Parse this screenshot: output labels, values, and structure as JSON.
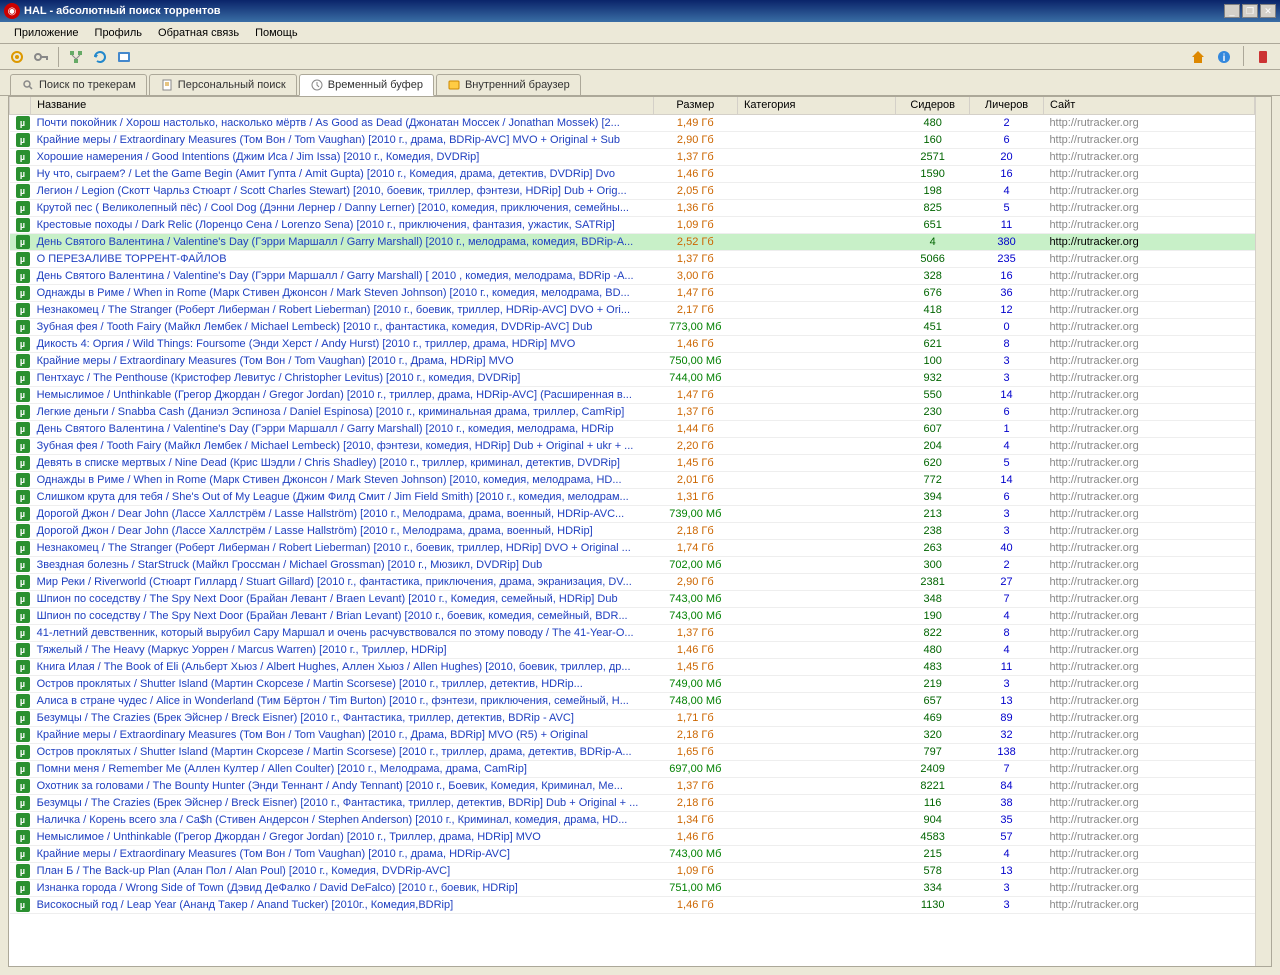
{
  "window": {
    "title": "HAL - абсолютный поиск торрентов"
  },
  "menu": {
    "items": [
      "Приложение",
      "Профиль",
      "Обратная связь",
      "Помощь"
    ]
  },
  "tabs": [
    {
      "icon": "search",
      "label": "Поиск по трекерам",
      "active": false
    },
    {
      "icon": "doc",
      "label": "Персональный поиск",
      "active": false
    },
    {
      "icon": "clock",
      "label": "Временный буфер",
      "active": true
    },
    {
      "icon": "globe",
      "label": "Внутренний браузер",
      "active": false
    }
  ],
  "columns": {
    "title": "Название",
    "size": "Размер",
    "category": "Категория",
    "seeders": "Сидеров",
    "leechers": "Личеров",
    "site": "Сайт"
  },
  "rows": [
    {
      "t": "Почти покойник / Хорош настолько, насколько мёртв / As Good as Dead (Джонатан Моссек / Jonathan Mossek) [2...",
      "s": "1,49 Гб",
      "sc": "o",
      "se": 480,
      "le": 2,
      "w": "http://rutracker.org"
    },
    {
      "t": "Крайние меры / Extraordinary Measures (Том Вон / Tom Vaughan) [2010 г., драма, BDRip-AVC] MVO + Original + Sub",
      "s": "2,90 Гб",
      "sc": "o",
      "se": 160,
      "le": 6,
      "w": "http://rutracker.org"
    },
    {
      "t": "Хорошие намерения / Good Intentions (Джим Иса / Jim Issa) [2010 г., Комедия, DVDRip]",
      "s": "1,37 Гб",
      "sc": "o",
      "se": 2571,
      "le": 20,
      "w": "http://rutracker.org"
    },
    {
      "t": "Ну что, сыграем? / Let the Game Begin (Амит Гупта / Amit Gupta) [2010 г., Комедия, драма, детектив, DVDRip] Dvo",
      "s": "1,46 Гб",
      "sc": "o",
      "se": 1590,
      "le": 16,
      "w": "http://rutracker.org"
    },
    {
      "t": "Легион / Legion (Скотт Чарльз Стюарт / Scott Charles Stewart) [2010, боевик, триллер, фэнтези, HDRip] Dub + Orig...",
      "s": "2,05 Гб",
      "sc": "o",
      "se": 198,
      "le": 4,
      "w": "http://rutracker.org"
    },
    {
      "t": "Крутой пес ( Великолепный пёс) / Cool Dog (Дэнни Лернер / Danny Lerner) [2010, комедия, приключения, семейны...",
      "s": "1,36 Гб",
      "sc": "o",
      "se": 825,
      "le": 5,
      "w": "http://rutracker.org"
    },
    {
      "t": "Крестовые походы / Dark Relic (Лоренцо Сена / Lorenzo Sena) [2010 г., приключения, фантазия, ужастик, SATRip]",
      "s": "1,09 Гб",
      "sc": "o",
      "se": 651,
      "le": 11,
      "w": "http://rutracker.org"
    },
    {
      "t": "День Святого Валентина / Valentine's Day (Гэрри Маршалл / Garry Marshall) [2010 г., мелодрама, комедия, BDRip-A...",
      "s": "2,52 Гб",
      "sc": "o",
      "se": 4,
      "le": 380,
      "w": "http://rutracker.org",
      "sel": true
    },
    {
      "t": "О ПЕРЕЗАЛИВЕ ТОРРЕНТ-ФАЙЛОВ",
      "s": "1,37 Гб",
      "sc": "o",
      "se": 5066,
      "le": 235,
      "w": "http://rutracker.org"
    },
    {
      "t": "День Святого Валентина / Valentine's Day (Гэрри Маршалл / Garry Marshall) [ 2010 , комедия, мелодрама, BDRip -A...",
      "s": "3,00 Гб",
      "sc": "o",
      "se": 328,
      "le": 16,
      "w": "http://rutracker.org"
    },
    {
      "t": "Однажды в Риме / When in Rome (Марк Стивен Джонсон / Mark Steven Johnson) [2010 г., комедия, мелодрама, BD...",
      "s": "1,47 Гб",
      "sc": "o",
      "se": 676,
      "le": 36,
      "w": "http://rutracker.org"
    },
    {
      "t": "Незнакомец / The Stranger (Роберт Либерман / Robert Lieberman) [2010 г., боевик, триллер, HDRip-AVC] DVO + Ori...",
      "s": "2,17 Гб",
      "sc": "o",
      "se": 418,
      "le": 12,
      "w": "http://rutracker.org"
    },
    {
      "t": "Зубная фея / Tooth Fairy (Майкл Лембек / Michael Lembeck) [2010 г., фантастика, комедия, DVDRip-AVC] Dub",
      "s": "773,00 Мб",
      "sc": "g",
      "se": 451,
      "le": 0,
      "w": "http://rutracker.org"
    },
    {
      "t": "Дикость 4: Оргия / Wild Things: Foursome (Энди Херст / Andy Hurst) [2010 г., триллер, драма, HDRip] MVO",
      "s": "1,46 Гб",
      "sc": "o",
      "se": 621,
      "le": 8,
      "w": "http://rutracker.org"
    },
    {
      "t": "Крайние меры / Extraordinary Measures (Том Вон / Tom Vaughan) [2010 г., Драма, HDRip] MVO",
      "s": "750,00 Мб",
      "sc": "g",
      "se": 100,
      "le": 3,
      "w": "http://rutracker.org"
    },
    {
      "t": "Пентхаус / The Penthouse (Кристофер Левитус / Christopher Levitus) [2010 г., комедия, DVDRip]",
      "s": "744,00 Мб",
      "sc": "g",
      "se": 932,
      "le": 3,
      "w": "http://rutracker.org"
    },
    {
      "t": "Немыслимое / Unthinkable (Грегор Джордан / Gregor Jordan) [2010 г., триллер, драма, HDRip-AVC] (Расширенная в...",
      "s": "1,47 Гб",
      "sc": "o",
      "se": 550,
      "le": 14,
      "w": "http://rutracker.org"
    },
    {
      "t": "Легкие деньги / Snabba Cash (Даниэл Эспиноза / Daniel Espinosa) [2010 г., криминальная драма, триллер, CamRip]",
      "s": "1,37 Гб",
      "sc": "o",
      "se": 230,
      "le": 6,
      "w": "http://rutracker.org"
    },
    {
      "t": "День Святого Валентина / Valentine's Day (Гэрри Маршалл / Garry Marshall) [2010 г., комедия, мелодрама, HDRip",
      "s": "1,44 Гб",
      "sc": "o",
      "se": 607,
      "le": 1,
      "w": "http://rutracker.org"
    },
    {
      "t": "Зубная фея / Tooth Fairy (Майкл Лембек / Michael Lembeck) [2010, фэнтези, комедия, HDRip] Dub + Original + ukr + ...",
      "s": "2,20 Гб",
      "sc": "o",
      "se": 204,
      "le": 4,
      "w": "http://rutracker.org"
    },
    {
      "t": "Девять в списке мертвых / Nine Dead (Крис Шэдли / Chris Shadley) [2010 г., триллер, криминал, детектив, DVDRip]",
      "s": "1,45 Гб",
      "sc": "o",
      "se": 620,
      "le": 5,
      "w": "http://rutracker.org"
    },
    {
      "t": "Однажды в Риме / When in Rome (Марк Стивен Джонсон / Mark Steven Johnson) [2010, комедия, мелодрама, HD...",
      "s": "2,01 Гб",
      "sc": "o",
      "se": 772,
      "le": 14,
      "w": "http://rutracker.org"
    },
    {
      "t": "Слишком крута для тебя / She's Out of My League (Джим Филд Смит / Jim Field Smith) [2010 г., комедия, мелодрам...",
      "s": "1,31 Гб",
      "sc": "o",
      "se": 394,
      "le": 6,
      "w": "http://rutracker.org"
    },
    {
      "t": "Дорогой Джон / Dear John (Лассе Халлстрём / Lasse Hallström) [2010 г., Мелодрама, драма, военный, HDRip-AVC...",
      "s": "739,00 Мб",
      "sc": "g",
      "se": 213,
      "le": 3,
      "w": "http://rutracker.org"
    },
    {
      "t": "Дорогой Джон / Dear John (Лассе Халлстрём / Lasse Hallström) [2010 г., Мелодрама, драма, военный, HDRip]",
      "s": "2,18 Гб",
      "sc": "o",
      "se": 238,
      "le": 3,
      "w": "http://rutracker.org"
    },
    {
      "t": "Незнакомец / The Stranger (Роберт Либерман / Robert Lieberman) [2010 г., боевик, триллер, HDRip] DVO + Original ...",
      "s": "1,74 Гб",
      "sc": "o",
      "se": 263,
      "le": 40,
      "w": "http://rutracker.org"
    },
    {
      "t": "Звездная болезнь / StarStruck (Майкл Гроссман / Michael Grossman) [2010 г., Мюзикл, DVDRip] Dub",
      "s": "702,00 Мб",
      "sc": "g",
      "se": 300,
      "le": 2,
      "w": "http://rutracker.org"
    },
    {
      "t": "Мир Реки / Riverworld (Стюарт Гиллард / Stuart Gillard) [2010 г., фантастика, приключения, драма, экранизация, DV...",
      "s": "2,90 Гб",
      "sc": "o",
      "se": 2381,
      "le": 27,
      "w": "http://rutracker.org"
    },
    {
      "t": "Шпион по соседству / The Spy Next Door (Брайан Левант / Braen Levant) [2010 г., Комедия, семейный, HDRip] Dub",
      "s": "743,00 Мб",
      "sc": "g",
      "se": 348,
      "le": 7,
      "w": "http://rutracker.org"
    },
    {
      "t": "Шпион по соседству / The Spy Next Door (Брайан Левант / Brian Levant) [2010 г., боевик, комедия, семейный, BDR...",
      "s": "743,00 Мб",
      "sc": "g",
      "se": 190,
      "le": 4,
      "w": "http://rutracker.org"
    },
    {
      "t": "41-летний девственник, который вырубил Сару Маршал и очень расчувствовался по этому поводу / The 41-Year-O...",
      "s": "1,37 Гб",
      "sc": "o",
      "se": 822,
      "le": 8,
      "w": "http://rutracker.org"
    },
    {
      "t": "Тяжелый / The Heavy (Маркус Уоррен / Marcus Warren) [2010 г., Триллер, HDRip]",
      "s": "1,46 Гб",
      "sc": "o",
      "se": 480,
      "le": 4,
      "w": "http://rutracker.org"
    },
    {
      "t": "Книга Илая / The Book of Eli (Альберт Хьюз / Albert Hughes, Аллен Хьюз / Allen Hughes) [2010, боевик, триллер, др...",
      "s": "1,45 Гб",
      "sc": "o",
      "se": 483,
      "le": 11,
      "w": "http://rutracker.org"
    },
    {
      "t": "Остров проклятых / Shutter Island (Мартин Скорсезе / Martin Scorsese) [2010 г., триллер, детектив, HDRip...",
      "s": "749,00 Мб",
      "sc": "g",
      "se": 219,
      "le": 3,
      "w": "http://rutracker.org"
    },
    {
      "t": "Алиса в стране чудес / Alice in Wonderland (Тим Бёртон / Tim Burton) [2010 г., фэнтези, приключения, семейный, H...",
      "s": "748,00 Мб",
      "sc": "g",
      "se": 657,
      "le": 13,
      "w": "http://rutracker.org"
    },
    {
      "t": "Безумцы / The Crazies (Брек Эйснер / Breck Eisner) [2010 г., Фантастика, триллер, детектив, BDRip - AVC]",
      "s": "1,71 Гб",
      "sc": "o",
      "se": 469,
      "le": 89,
      "w": "http://rutracker.org"
    },
    {
      "t": "Крайние меры / Extraordinary Measures (Том Вон / Tom Vaughan) [2010 г., Драма, BDRip] MVO (R5) + Original",
      "s": "2,18 Гб",
      "sc": "o",
      "se": 320,
      "le": 32,
      "w": "http://rutracker.org"
    },
    {
      "t": "Остров проклятых / Shutter Island (Мартин Скорсезе / Martin Scorsese) [2010 г., триллер, драма, детектив, BDRip-A...",
      "s": "1,65 Гб",
      "sc": "o",
      "se": 797,
      "le": 138,
      "w": "http://rutracker.org"
    },
    {
      "t": "Помни меня / Remember Me (Аллен Култер / Allen Coulter) [2010 г., Мелодрама, драма, CamRip]",
      "s": "697,00 Мб",
      "sc": "g",
      "se": 2409,
      "le": 7,
      "w": "http://rutracker.org"
    },
    {
      "t": "Охотник за головами / The Bounty Hunter (Энди Теннант / Andy Tennant) [2010 г., Боевик, Комедия, Криминал, Ме...",
      "s": "1,37 Гб",
      "sc": "o",
      "se": 8221,
      "le": 84,
      "w": "http://rutracker.org"
    },
    {
      "t": "Безумцы / The Crazies (Брек Эйснер / Breck Eisner) [2010 г., Фантастика, триллер, детектив, BDRip] Dub + Original + ...",
      "s": "2,18 Гб",
      "sc": "o",
      "se": 116,
      "le": 38,
      "w": "http://rutracker.org"
    },
    {
      "t": "Наличка / Корень всего зла / Ca$h (Стивен Андерсон / Stephen Anderson) [2010 г., Криминал, комедия, драма, HD...",
      "s": "1,34 Гб",
      "sc": "o",
      "se": 904,
      "le": 35,
      "w": "http://rutracker.org"
    },
    {
      "t": "Немыслимое / Unthinkable (Грегор Джордан / Gregor Jordan) [2010 г., Триллер, драма, HDRip] MVO",
      "s": "1,46 Гб",
      "sc": "o",
      "se": 4583,
      "le": 57,
      "w": "http://rutracker.org"
    },
    {
      "t": "Крайние меры / Extraordinary Measures (Том Вон / Tom Vaughan) [2010 г., драма, HDRip-AVC]",
      "s": "743,00 Мб",
      "sc": "g",
      "se": 215,
      "le": 4,
      "w": "http://rutracker.org"
    },
    {
      "t": "План Б / The Back-up Plan (Алан Пол / Alan Poul) [2010 г., Комедия, DVDRip-AVC]",
      "s": "1,09 Гб",
      "sc": "o",
      "se": 578,
      "le": 13,
      "w": "http://rutracker.org"
    },
    {
      "t": "Изнанка города / Wrong Side of Town (Дэвид ДеФалко / David DeFalco) [2010 г., боевик, HDRip]",
      "s": "751,00 Мб",
      "sc": "g",
      "se": 334,
      "le": 3,
      "w": "http://rutracker.org"
    },
    {
      "t": "Високосный год / Leap Year (Ананд Такер / Anand Tucker) [2010г., Комедия,BDRip]",
      "s": "1,46 Гб",
      "sc": "o",
      "se": 1130,
      "le": 3,
      "w": "http://rutracker.org"
    }
  ]
}
